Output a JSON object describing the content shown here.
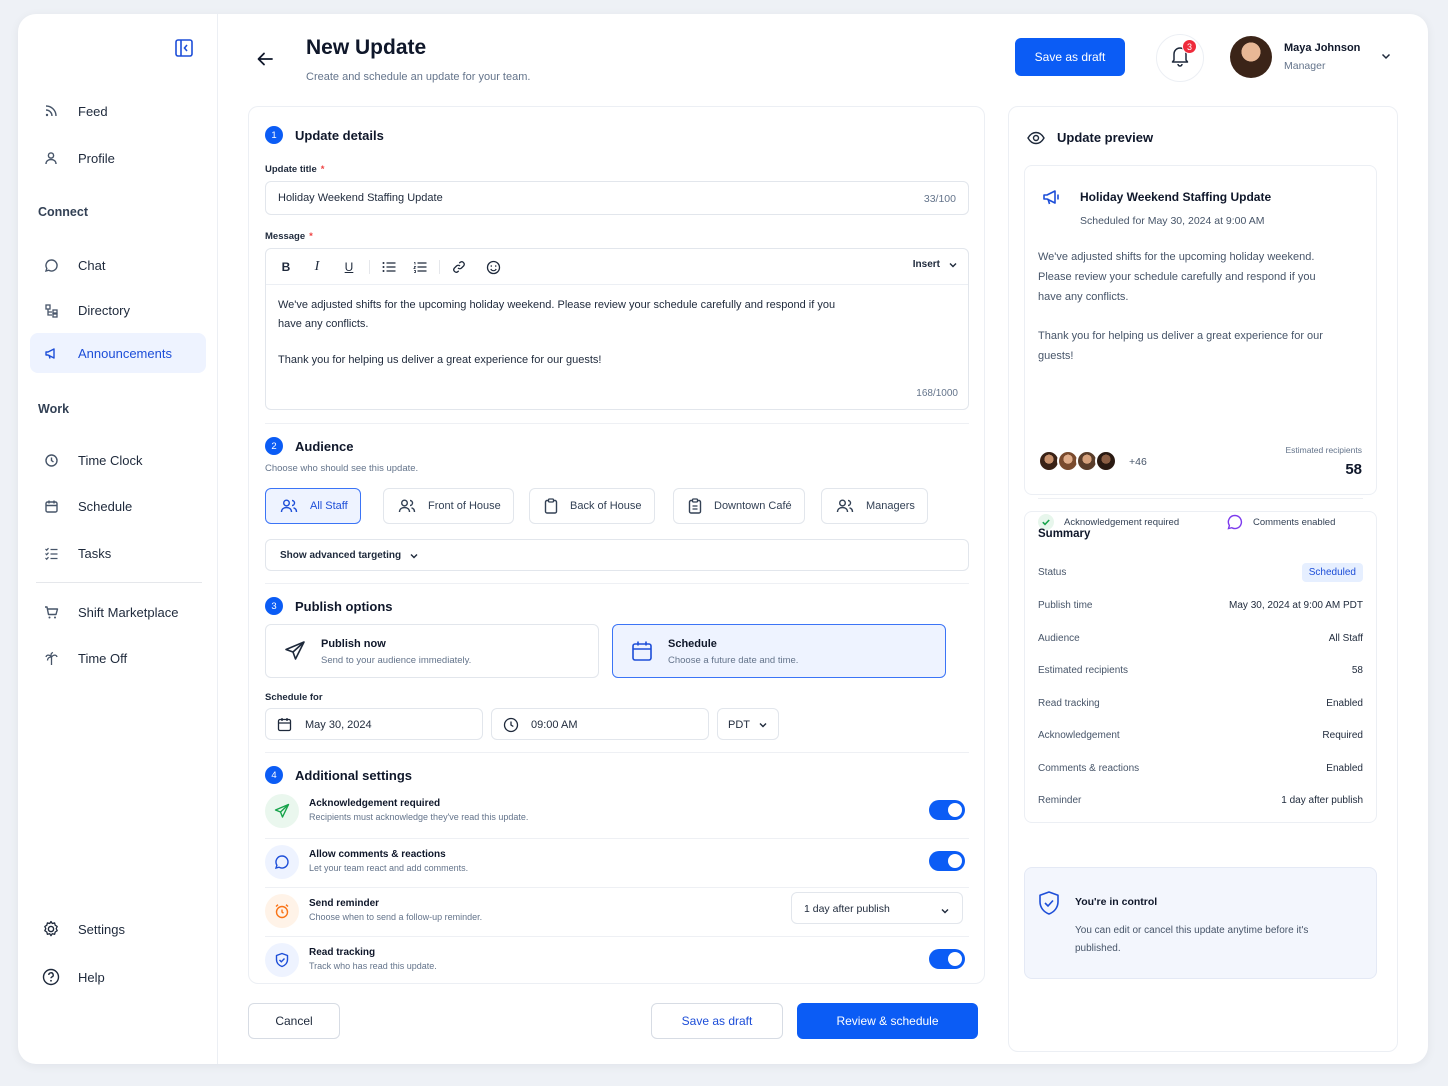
{
  "sidebar": {
    "items": [
      {
        "label": "Feed",
        "icon": "rss-icon"
      },
      {
        "label": "Profile",
        "icon": "user-icon"
      },
      {
        "label": "Chat",
        "icon": "chat-icon"
      },
      {
        "label": "Directory",
        "icon": "directory-icon"
      },
      {
        "label": "Announcements",
        "icon": "megaphone-icon",
        "active": true
      },
      {
        "label": "Time Clock",
        "icon": "clock-icon"
      },
      {
        "label": "Schedule",
        "icon": "calendar-icon"
      },
      {
        "label": "Tasks",
        "icon": "tasks-icon"
      },
      {
        "label": "Shift Marketplace",
        "icon": "cart-icon"
      },
      {
        "label": "Time Off",
        "icon": "palm-tree-icon"
      },
      {
        "label": "Settings",
        "icon": "gear-icon"
      },
      {
        "label": "Help",
        "icon": "help-icon"
      }
    ],
    "sections": {
      "connect": "Connect",
      "work": "Work"
    }
  },
  "header": {
    "title": "New Update",
    "subtitle": "Create and schedule an update for your team.",
    "save_draft": "Save as draft",
    "notifications_count": "3",
    "user_name": "Maya Johnson",
    "user_role": "Manager"
  },
  "details": {
    "step": "1",
    "heading": "Update details",
    "title_label": "Update title",
    "required_mark": "*",
    "title_value": "Holiday Weekend Staffing Update",
    "title_count": "33/100",
    "message_label": "Message",
    "insert_label": "Insert",
    "message_p1": "We've adjusted shifts for the upcoming holiday weekend. Please review your schedule carefully and respond if you have any conflicts.",
    "message_p2": "Thank you for helping us deliver a great experience for our guests!",
    "message_count": "168/1000"
  },
  "audience": {
    "step": "2",
    "heading": "Audience",
    "hint": "Choose who should see this update.",
    "chips": [
      {
        "label": "All Staff",
        "selected": true
      },
      {
        "label": "Front of House"
      },
      {
        "label": "Back of House"
      },
      {
        "label": "Downtown Café"
      },
      {
        "label": "Managers"
      }
    ],
    "advanced": "Show advanced targeting"
  },
  "publish": {
    "step": "3",
    "heading": "Publish options",
    "now_title": "Publish now",
    "now_sub": "Send to your audience immediately.",
    "schedule_title": "Schedule",
    "schedule_sub": "Choose a future date and time.",
    "schedule_for_label": "Schedule for",
    "date": "May 30, 2024",
    "time": "09:00 AM",
    "timezone": "PDT"
  },
  "settings": {
    "step": "4",
    "heading": "Additional settings",
    "items": [
      {
        "title": "Acknowledgement required",
        "sub": "Recipients must acknowledge they've read this update.",
        "on": true
      },
      {
        "title": "Allow comments & reactions",
        "sub": "Let your team react and add comments.",
        "on": true
      },
      {
        "title": "Send reminder",
        "sub": "Choose when to send a follow-up reminder.",
        "value": "1 day after publish"
      },
      {
        "title": "Read tracking",
        "sub": "Track who has read this update.",
        "on": true
      }
    ]
  },
  "footer": {
    "cancel": "Cancel",
    "save_draft": "Save as draft",
    "review": "Review & schedule"
  },
  "preview": {
    "heading": "Update preview",
    "title": "Holiday Weekend Staffing Update",
    "scheduled": "Scheduled for May 30, 2024 at 9:00 AM",
    "body_p1": "We've adjusted shifts for the upcoming holiday weekend. Please review your schedule carefully and respond if you have any conflicts.",
    "body_p2": "Thank you for helping us deliver a great experience for our guests!",
    "more_count": "+46",
    "est_label": "Estimated recipients",
    "est_value": "58",
    "ack": "Acknowledgement required",
    "comments": "Comments enabled"
  },
  "summary": {
    "heading": "Summary",
    "rows": [
      {
        "k": "Status",
        "v": "Scheduled"
      },
      {
        "k": "Publish time",
        "v": "May 30, 2024 at 9:00 AM PDT"
      },
      {
        "k": "Audience",
        "v": "All Staff"
      },
      {
        "k": "Estimated recipients",
        "v": "58"
      },
      {
        "k": "Read tracking",
        "v": "Enabled"
      },
      {
        "k": "Acknowledgement",
        "v": "Required"
      },
      {
        "k": "Comments & reactions",
        "v": "Enabled"
      },
      {
        "k": "Reminder",
        "v": "1 day after publish"
      }
    ]
  },
  "control": {
    "title": "You're in control",
    "body": "You can edit or cancel this update anytime before it's published."
  },
  "colors": {
    "accent": "#0b5cf5",
    "badge": "#ef2b3b",
    "selected_bg": "#eef3ff"
  }
}
